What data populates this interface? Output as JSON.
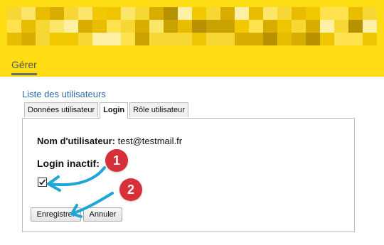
{
  "header": {
    "background_color": "#ffdd14",
    "redacted_banner": "pixelated-title-image",
    "nav_tab": "Gérer"
  },
  "user_list_link": "Liste des utilisateurs",
  "tabs": [
    {
      "label": "Données utilisateur",
      "active": false
    },
    {
      "label": "Login",
      "active": true
    },
    {
      "label": "Rôle utilisateur",
      "active": false
    }
  ],
  "form": {
    "username_label": "Nom d'utilisateur:",
    "username_value": "test@testmail.fr",
    "inactive_label": "Login inactif:",
    "inactive_checked": true
  },
  "buttons": {
    "save": "Enregistrer",
    "cancel": "Annuler"
  },
  "annotations": {
    "badge1": "1",
    "badge2": "2",
    "badge_color": "#d7303a",
    "arrow_color": "#1fa6d6"
  }
}
